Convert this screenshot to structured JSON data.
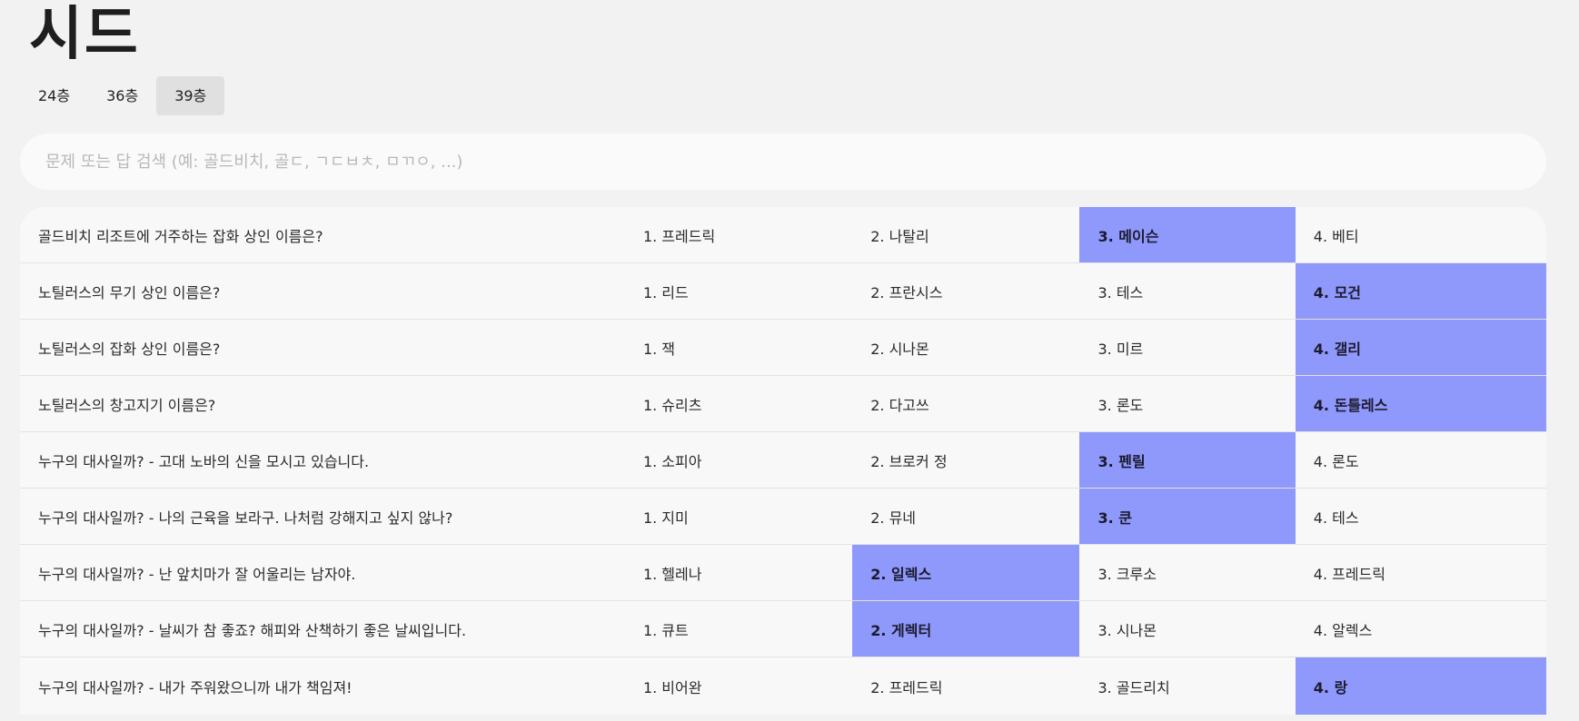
{
  "title": "시드",
  "tabs": [
    {
      "label": "24층",
      "active": false
    },
    {
      "label": "36층",
      "active": false
    },
    {
      "label": "39층",
      "active": true
    }
  ],
  "search": {
    "placeholder": "문제 또는 답 검색 (예: 골드비치, 골ㄷ, ㄱㄷㅂㅊ, ㅁㄲㅇ, ...)",
    "value": ""
  },
  "colors": {
    "correct_highlight": "#8f98fb",
    "tab_active": "#e0e0e0"
  },
  "rows": [
    {
      "question": "골드비치 리조트에 거주하는 잡화 상인 이름은?",
      "options": [
        "1. 프레드릭",
        "2. 나탈리",
        "3. 메이슨",
        "4. 베티"
      ],
      "answer": 3
    },
    {
      "question": "노틸러스의 무기 상인 이름은?",
      "options": [
        "1. 리드",
        "2. 프란시스",
        "3. 테스",
        "4. 모건"
      ],
      "answer": 4
    },
    {
      "question": "노틸러스의 잡화 상인 이름은?",
      "options": [
        "1. 잭",
        "2. 시나몬",
        "3. 미르",
        "4. 갤리"
      ],
      "answer": 4
    },
    {
      "question": "노틸러스의 창고지기 이름은?",
      "options": [
        "1. 슈리츠",
        "2. 다고쓰",
        "3. 론도",
        "4. 돈틀레스"
      ],
      "answer": 4
    },
    {
      "question": "누구의 대사일까? - 고대 노바의 신을 모시고 있습니다.",
      "options": [
        "1. 소피아",
        "2. 브로커 정",
        "3. 펜릴",
        "4. 론도"
      ],
      "answer": 3
    },
    {
      "question": "누구의 대사일까? - 나의 근육을 보라구. 나처럼 강해지고 싶지 않나?",
      "options": [
        "1. 지미",
        "2. 뮤네",
        "3. 쿤",
        "4. 테스"
      ],
      "answer": 3
    },
    {
      "question": "누구의 대사일까? - 난 앞치마가 잘 어울리는 남자야.",
      "options": [
        "1. 헬레나",
        "2. 일렉스",
        "3. 크루소",
        "4. 프레드릭"
      ],
      "answer": 2
    },
    {
      "question": "누구의 대사일까? - 날씨가 참 좋죠? 해피와 산책하기 좋은 날씨입니다.",
      "options": [
        "1. 큐트",
        "2. 게렉터",
        "3. 시나몬",
        "4. 알렉스"
      ],
      "answer": 2
    },
    {
      "question": "누구의 대사일까? - 내가 주워왔으니까 내가 책임져!",
      "options": [
        "1. 비어완",
        "2. 프레드릭",
        "3. 골드리치",
        "4. 랑"
      ],
      "answer": 4
    }
  ]
}
